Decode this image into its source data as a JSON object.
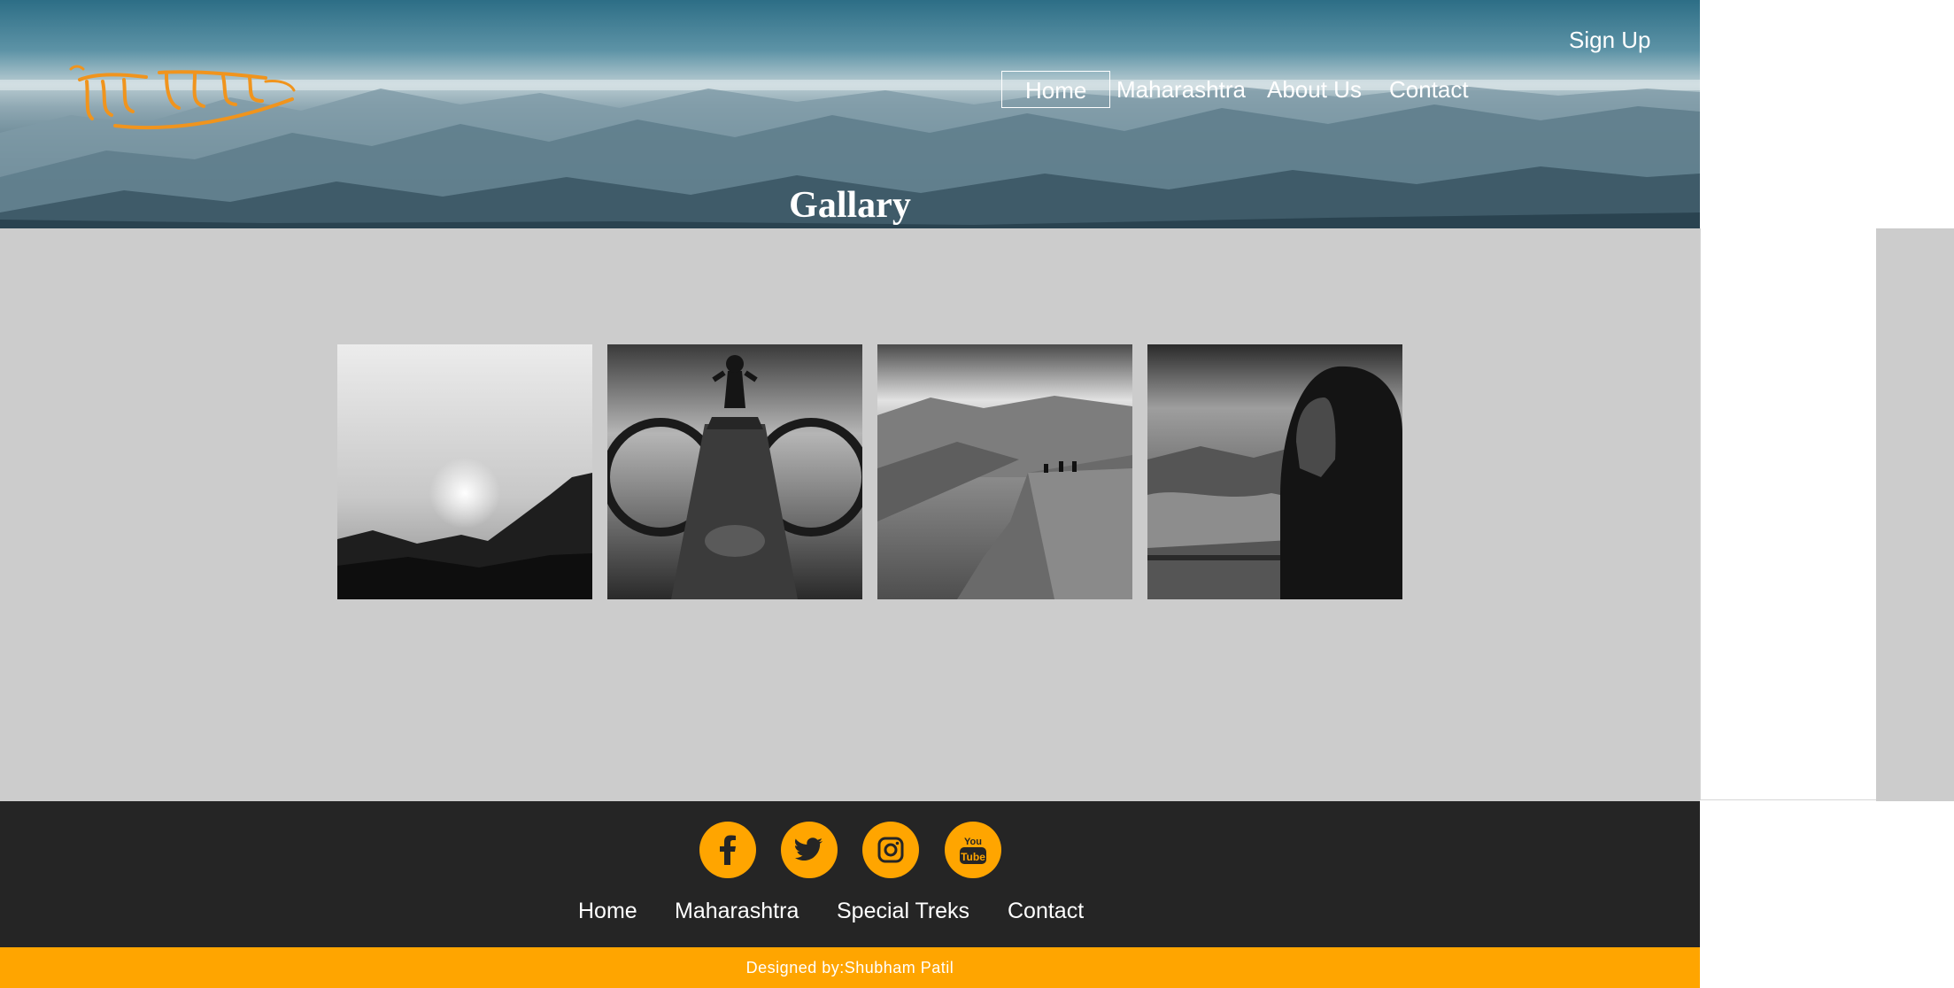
{
  "brand": {
    "logo_text": "महाराष्ट्र देशा",
    "accent": "#ffa500"
  },
  "header": {
    "signup_label": "Sign Up",
    "nav": [
      {
        "label": "Home",
        "active": true
      },
      {
        "label": "Maharashtra",
        "active": false
      },
      {
        "label": "About Us",
        "active": false
      },
      {
        "label": "Contact",
        "active": false
      }
    ],
    "page_title": "Gallary"
  },
  "gallery": {
    "background": "#cccccc",
    "photos": [
      {
        "subject": "sunset over cliff"
      },
      {
        "subject": "person standing behind fort cannon"
      },
      {
        "subject": "people on cliff edge over valley"
      },
      {
        "subject": "hooded man overlooking lake"
      }
    ]
  },
  "footer": {
    "background": "#252525",
    "social": [
      {
        "icon": "facebook-icon"
      },
      {
        "icon": "twitter-icon"
      },
      {
        "icon": "instagram-icon"
      },
      {
        "icon": "youtube-icon",
        "text_top": "You",
        "text_bottom": "Tube"
      }
    ],
    "links": [
      "Home",
      "Maharashtra",
      "Special Treks",
      "Contact"
    ],
    "credit": "Designed by:Shubham Patil"
  }
}
